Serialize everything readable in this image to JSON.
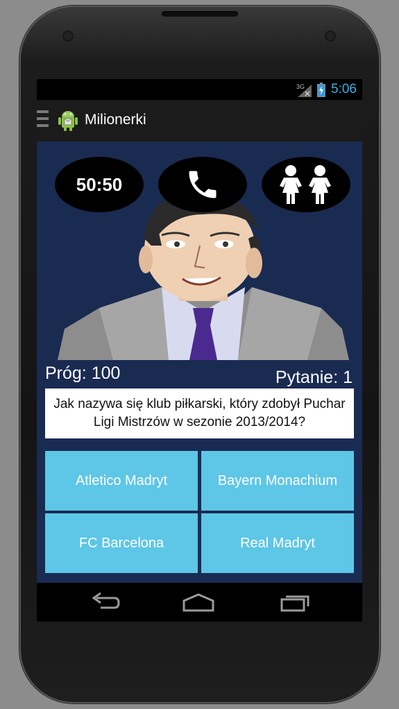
{
  "status_bar": {
    "network": "3G",
    "time": "5:06"
  },
  "action_bar": {
    "title": "Milionerki",
    "icon": "android-app-icon"
  },
  "lifelines": {
    "fifty_fifty_label": "50:50",
    "phone_icon": "phone-icon",
    "audience_icon": "audience-icon"
  },
  "game": {
    "threshold_label": "Próg: 100",
    "question_number_label": "Pytanie: 1",
    "question": "Jak nazywa się klub piłkarski, który zdobył Puchar Ligi Mistrzów w sezonie 2013/2014?"
  },
  "answers": [
    {
      "label": "Atletico Madryt"
    },
    {
      "label": "Bayern Monachium"
    },
    {
      "label": "FC Barcelona"
    },
    {
      "label": "Real Madryt"
    }
  ],
  "navigation": {
    "back_icon": "back-icon",
    "home_icon": "home-icon",
    "recents_icon": "recents-icon"
  },
  "colors": {
    "background": "#1a2b52",
    "answer_button": "#5ec6e6",
    "clock": "#3ab0e6"
  }
}
